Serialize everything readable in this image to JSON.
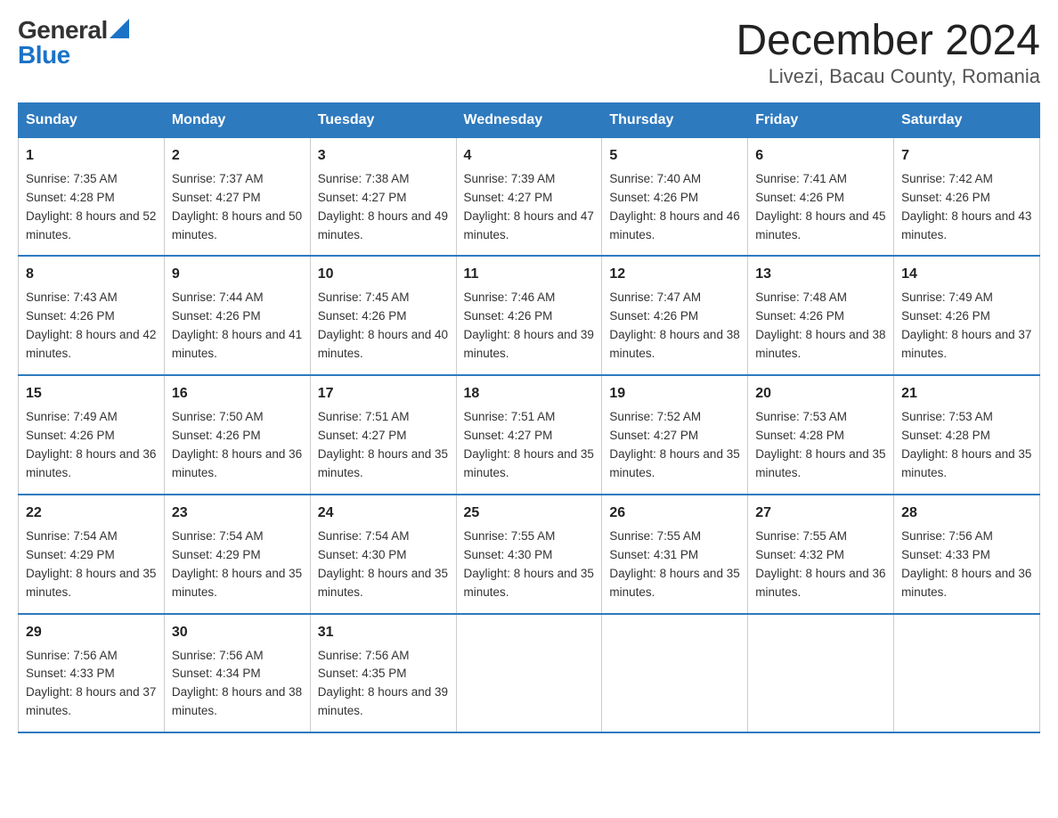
{
  "header": {
    "logo_general": "General",
    "logo_blue": "Blue",
    "main_title": "December 2024",
    "subtitle": "Livezi, Bacau County, Romania"
  },
  "days_of_week": [
    "Sunday",
    "Monday",
    "Tuesday",
    "Wednesday",
    "Thursday",
    "Friday",
    "Saturday"
  ],
  "weeks": [
    [
      {
        "day": "1",
        "sunrise": "7:35 AM",
        "sunset": "4:28 PM",
        "daylight": "8 hours and 52 minutes."
      },
      {
        "day": "2",
        "sunrise": "7:37 AM",
        "sunset": "4:27 PM",
        "daylight": "8 hours and 50 minutes."
      },
      {
        "day": "3",
        "sunrise": "7:38 AM",
        "sunset": "4:27 PM",
        "daylight": "8 hours and 49 minutes."
      },
      {
        "day": "4",
        "sunrise": "7:39 AM",
        "sunset": "4:27 PM",
        "daylight": "8 hours and 47 minutes."
      },
      {
        "day": "5",
        "sunrise": "7:40 AM",
        "sunset": "4:26 PM",
        "daylight": "8 hours and 46 minutes."
      },
      {
        "day": "6",
        "sunrise": "7:41 AM",
        "sunset": "4:26 PM",
        "daylight": "8 hours and 45 minutes."
      },
      {
        "day": "7",
        "sunrise": "7:42 AM",
        "sunset": "4:26 PM",
        "daylight": "8 hours and 43 minutes."
      }
    ],
    [
      {
        "day": "8",
        "sunrise": "7:43 AM",
        "sunset": "4:26 PM",
        "daylight": "8 hours and 42 minutes."
      },
      {
        "day": "9",
        "sunrise": "7:44 AM",
        "sunset": "4:26 PM",
        "daylight": "8 hours and 41 minutes."
      },
      {
        "day": "10",
        "sunrise": "7:45 AM",
        "sunset": "4:26 PM",
        "daylight": "8 hours and 40 minutes."
      },
      {
        "day": "11",
        "sunrise": "7:46 AM",
        "sunset": "4:26 PM",
        "daylight": "8 hours and 39 minutes."
      },
      {
        "day": "12",
        "sunrise": "7:47 AM",
        "sunset": "4:26 PM",
        "daylight": "8 hours and 38 minutes."
      },
      {
        "day": "13",
        "sunrise": "7:48 AM",
        "sunset": "4:26 PM",
        "daylight": "8 hours and 38 minutes."
      },
      {
        "day": "14",
        "sunrise": "7:49 AM",
        "sunset": "4:26 PM",
        "daylight": "8 hours and 37 minutes."
      }
    ],
    [
      {
        "day": "15",
        "sunrise": "7:49 AM",
        "sunset": "4:26 PM",
        "daylight": "8 hours and 36 minutes."
      },
      {
        "day": "16",
        "sunrise": "7:50 AM",
        "sunset": "4:26 PM",
        "daylight": "8 hours and 36 minutes."
      },
      {
        "day": "17",
        "sunrise": "7:51 AM",
        "sunset": "4:27 PM",
        "daylight": "8 hours and 35 minutes."
      },
      {
        "day": "18",
        "sunrise": "7:51 AM",
        "sunset": "4:27 PM",
        "daylight": "8 hours and 35 minutes."
      },
      {
        "day": "19",
        "sunrise": "7:52 AM",
        "sunset": "4:27 PM",
        "daylight": "8 hours and 35 minutes."
      },
      {
        "day": "20",
        "sunrise": "7:53 AM",
        "sunset": "4:28 PM",
        "daylight": "8 hours and 35 minutes."
      },
      {
        "day": "21",
        "sunrise": "7:53 AM",
        "sunset": "4:28 PM",
        "daylight": "8 hours and 35 minutes."
      }
    ],
    [
      {
        "day": "22",
        "sunrise": "7:54 AM",
        "sunset": "4:29 PM",
        "daylight": "8 hours and 35 minutes."
      },
      {
        "day": "23",
        "sunrise": "7:54 AM",
        "sunset": "4:29 PM",
        "daylight": "8 hours and 35 minutes."
      },
      {
        "day": "24",
        "sunrise": "7:54 AM",
        "sunset": "4:30 PM",
        "daylight": "8 hours and 35 minutes."
      },
      {
        "day": "25",
        "sunrise": "7:55 AM",
        "sunset": "4:30 PM",
        "daylight": "8 hours and 35 minutes."
      },
      {
        "day": "26",
        "sunrise": "7:55 AM",
        "sunset": "4:31 PM",
        "daylight": "8 hours and 35 minutes."
      },
      {
        "day": "27",
        "sunrise": "7:55 AM",
        "sunset": "4:32 PM",
        "daylight": "8 hours and 36 minutes."
      },
      {
        "day": "28",
        "sunrise": "7:56 AM",
        "sunset": "4:33 PM",
        "daylight": "8 hours and 36 minutes."
      }
    ],
    [
      {
        "day": "29",
        "sunrise": "7:56 AM",
        "sunset": "4:33 PM",
        "daylight": "8 hours and 37 minutes."
      },
      {
        "day": "30",
        "sunrise": "7:56 AM",
        "sunset": "4:34 PM",
        "daylight": "8 hours and 38 minutes."
      },
      {
        "day": "31",
        "sunrise": "7:56 AM",
        "sunset": "4:35 PM",
        "daylight": "8 hours and 39 minutes."
      },
      null,
      null,
      null,
      null
    ]
  ],
  "labels": {
    "sunrise": "Sunrise:",
    "sunset": "Sunset:",
    "daylight": "Daylight:"
  }
}
